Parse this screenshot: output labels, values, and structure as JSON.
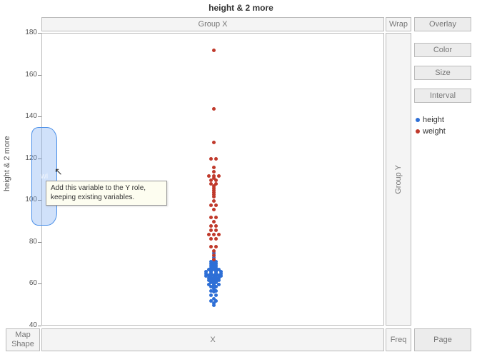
{
  "title": "height & 2 more",
  "zones": {
    "groupX": "Group X",
    "groupY": "Group Y",
    "wrap": "Wrap",
    "x": "X",
    "mapShape": "Map\nShape",
    "freq": "Freq",
    "page": "Page"
  },
  "panelButtons": {
    "overlay": "Overlay",
    "color": "Color",
    "size": "Size",
    "interval": "Interval"
  },
  "axis": {
    "yLabel": "height & 2 more"
  },
  "legend": {
    "items": [
      {
        "name": "height",
        "color": "#2e6fd6"
      },
      {
        "name": "weight",
        "color": "#c0392b"
      }
    ]
  },
  "drop": {
    "ghost": "wi",
    "tooltip": "Add this variable to the Y role, keeping existing variables."
  },
  "chart_data": {
    "type": "scatter",
    "title": "height & 2 more",
    "ylabel": "height & 2 more",
    "xlabel": "",
    "ylim": [
      40,
      180
    ],
    "y_ticks": [
      40,
      60,
      80,
      100,
      120,
      140,
      160,
      180
    ],
    "series": [
      {
        "name": "height",
        "color": "#2e6fd6",
        "values": [
          50,
          51,
          52,
          52,
          53,
          55,
          55,
          56.5,
          57,
          57,
          58,
          58.5,
          59,
          59,
          59.5,
          60,
          60,
          60,
          60.5,
          61,
          61,
          61.5,
          61.5,
          62,
          62,
          62,
          62.5,
          62.5,
          63,
          63,
          63,
          63.5,
          63.5,
          64,
          64,
          64,
          64,
          64.5,
          64.5,
          64.5,
          65,
          65,
          65,
          65,
          65.5,
          65.5,
          66,
          66,
          66,
          66,
          66.5,
          66.5,
          67,
          67,
          67,
          67.5,
          67.5,
          68,
          68,
          68.5,
          69,
          69,
          69.5,
          70,
          70,
          70.5,
          71,
          71,
          72,
          73,
          75
        ]
      },
      {
        "name": "weight",
        "color": "#c0392b",
        "values": [
          72,
          74,
          76,
          78,
          78,
          82,
          82,
          84,
          84,
          84,
          86,
          86,
          88,
          88,
          90,
          92,
          92,
          96,
          98,
          98,
          100,
          102,
          103,
          104,
          105,
          106,
          107,
          108,
          108,
          110,
          110,
          111,
          112,
          112,
          112,
          114,
          116,
          120,
          120,
          128,
          144,
          172
        ]
      }
    ]
  }
}
